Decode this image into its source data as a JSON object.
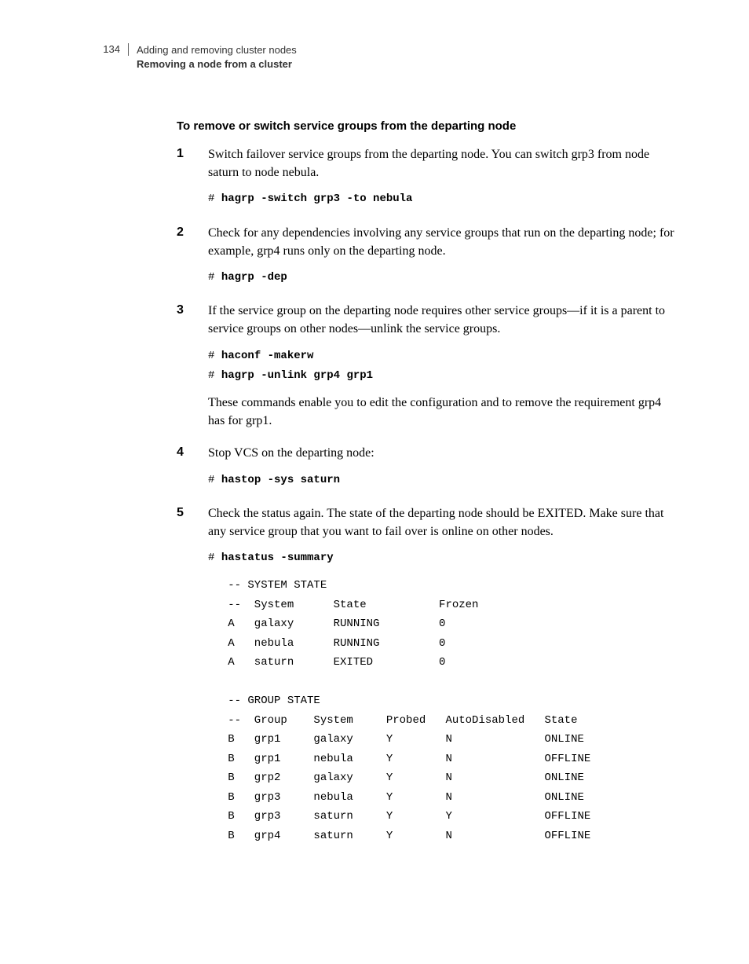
{
  "header": {
    "page_number": "134",
    "chapter": "Adding and removing cluster nodes",
    "section": "Removing a node from a cluster"
  },
  "intro_title": "To remove or switch service groups from the departing node",
  "steps": [
    {
      "text": "Switch failover service groups from the departing node. You can switch grp3 from node saturn to node nebula.",
      "cmds": [
        "hagrp -switch grp3 -to nebula"
      ]
    },
    {
      "text": "Check for any dependencies involving any service groups that run on the departing node; for example, grp4 runs only on the departing node.",
      "cmds": [
        "hagrp -dep"
      ]
    },
    {
      "text": "If the service group on the departing node requires other service groups—if it is a parent to service groups on other nodes—unlink the service groups.",
      "cmds": [
        "haconf -makerw",
        "hagrp -unlink grp4 grp1"
      ],
      "after": "These commands enable you to edit the configuration and to remove the requirement grp4 has for grp1."
    },
    {
      "text": "Stop VCS on the departing node:",
      "cmds": [
        "hastop -sys saturn"
      ]
    },
    {
      "text": "Check the status again. The state of the departing node should be EXITED. Make sure that any service group that you want to fail over is online on other nodes.",
      "cmds": [
        "hastatus -summary"
      ]
    }
  ],
  "chart_data": {
    "type": "table",
    "system_state": {
      "title": "-- SYSTEM STATE",
      "columns": [
        "--",
        "System",
        "State",
        "Frozen"
      ],
      "rows": [
        [
          "A",
          "galaxy",
          "RUNNING",
          "0"
        ],
        [
          "A",
          "nebula",
          "RUNNING",
          "0"
        ],
        [
          "A",
          "saturn",
          "EXITED",
          "0"
        ]
      ]
    },
    "group_state": {
      "title": "-- GROUP STATE",
      "columns": [
        "--",
        "Group",
        "System",
        "Probed",
        "AutoDisabled",
        "State"
      ],
      "rows": [
        [
          "B",
          "grp1",
          "galaxy",
          "Y",
          "N",
          "ONLINE"
        ],
        [
          "B",
          "grp1",
          "nebula",
          "Y",
          "N",
          "OFFLINE"
        ],
        [
          "B",
          "grp2",
          "galaxy",
          "Y",
          "N",
          "ONLINE"
        ],
        [
          "B",
          "grp3",
          "nebula",
          "Y",
          "N",
          "ONLINE"
        ],
        [
          "B",
          "grp3",
          "saturn",
          "Y",
          "Y",
          "OFFLINE"
        ],
        [
          "B",
          "grp4",
          "saturn",
          "Y",
          "N",
          "OFFLINE"
        ]
      ]
    }
  }
}
